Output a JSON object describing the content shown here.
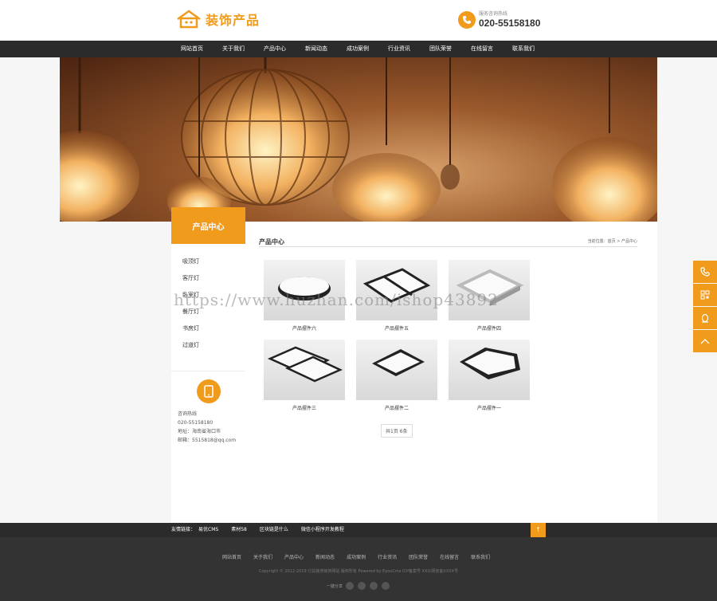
{
  "header": {
    "logo_text": "装饰产品",
    "hotline_label": "服务咨询热线",
    "hotline_number": "020-55158180"
  },
  "nav": [
    "网站首页",
    "关于我们",
    "产品中心",
    "新闻动态",
    "成功案例",
    "行业资讯",
    "团队荣誉",
    "在线留言",
    "联系我们"
  ],
  "sidebar": {
    "title": "产品中心",
    "items": [
      "吸顶灯",
      "客厅灯",
      "卧室灯",
      "餐厅灯",
      "书房灯",
      "过道灯"
    ],
    "contact": {
      "hotline_label": "咨询热线",
      "phone": "020-55158180",
      "address": "地址：海南省海口市",
      "email": "邮箱：5515818@qq.com"
    }
  },
  "content": {
    "title": "产品中心",
    "breadcrumb": "当前位置：首页 > 产品中心",
    "products": [
      {
        "name": "产品摆件六"
      },
      {
        "name": "产品摆件五"
      },
      {
        "name": "产品摆件四"
      },
      {
        "name": "产品摆件三"
      },
      {
        "name": "产品摆件二"
      },
      {
        "name": "产品摆件一"
      }
    ],
    "pager": "共1页 6条"
  },
  "watermark": "https://www.huzhan.com/ishop43892",
  "friend_links": {
    "label": "友情链接：",
    "items": [
      "易优CMS",
      "素材58",
      "区块链是什么",
      "微信小程序开发教程"
    ]
  },
  "to_top": "↑",
  "footer": {
    "nav": [
      "网站首页",
      "关于我们",
      "产品中心",
      "新闻动态",
      "成功案例",
      "行业资讯",
      "团队荣誉",
      "在线留言",
      "联系我们"
    ],
    "copyright": "Copyright © 2012-2019 灯具装修装饰网站 版权所有 Powered by EyouCms    ICP备案号    XX公网安备XXXX号",
    "share_label": "一键分享"
  },
  "colors": {
    "accent": "#f19b1c",
    "nav_bg": "#2b2b2b",
    "footer_bg": "#333333"
  },
  "icons": [
    "logo-house-icon",
    "phone-icon",
    "wechat-icon",
    "qrcode-icon",
    "qq-icon",
    "arrow-up-icon"
  ]
}
